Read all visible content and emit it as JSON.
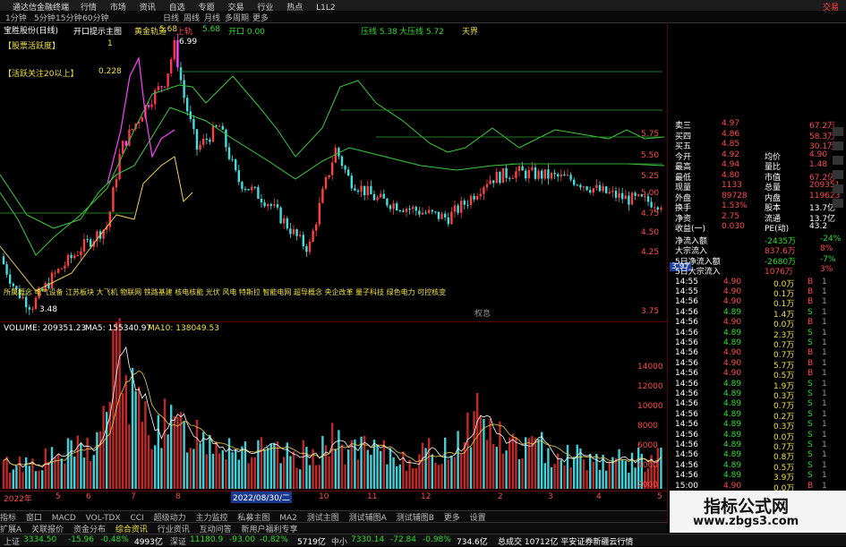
{
  "titlebar": {
    "app_title": "通达信金融终端",
    "menu": [
      "行情",
      "市场",
      "资讯",
      "自选",
      "专题",
      "交易",
      "行业",
      "热点",
      "L1L2"
    ],
    "close_label": "交易"
  },
  "toolbar": {
    "items": [
      "1分钟",
      "5分钟",
      "15分钟",
      "60分钟",
      "日线",
      "周线",
      "月线",
      "多周期",
      "更多"
    ]
  },
  "chart_header": {
    "stock": "宝胜股份(日线)",
    "line1": "开口提示主图",
    "line2": "黄金轨道",
    "val1": "5.68",
    "line3": "上轨",
    "val2": "5.68",
    "line4": "开口 0.00",
    "pressure": "压线 5.38",
    "big_pressure": "大压线 5.72",
    "tianzhou": "天界"
  },
  "labels": {
    "left1": "【股票活跃度】",
    "left1_val": "1",
    "left2": "【活跃关注20以上】",
    "left2_val": "0.228",
    "peak_price": "6.99",
    "low_price": "3.48",
    "concepts": "所属概念 电气设备 江苏板块 大飞机 物联网 铁路基建 核电核能 光伏 风电 特斯拉 智能电网 超导概念 央企改革 量子科技 绿色电力 可控核变",
    "fenhong": "权息"
  },
  "price_axis": [
    "5.75",
    "5.50",
    "5.25",
    "5.00",
    "4.75",
    "4.50",
    "4.25",
    "3.97",
    "3.75"
  ],
  "volume_header": {
    "label": "VOLUME: 209351.23",
    "ma5": "MA5: 155340.97",
    "ma10": "MA10: 138049.53"
  },
  "volume_axis": [
    "14000",
    "12000",
    "10000",
    "8000",
    "6000",
    "4000",
    "2000"
  ],
  "date_label": "2022/08/30/二",
  "date_axis": [
    "2022年",
    "5",
    "6",
    "7",
    "8",
    "9",
    "10",
    "11",
    "12",
    "2",
    "3",
    "4",
    "5"
  ],
  "bottom_tabs": [
    "指标",
    "窗口",
    "MACD",
    "VOL-TDX",
    "CCI",
    "超级动力",
    "主力监控",
    "私募主图",
    "MA2",
    "测试主图",
    "测试辅图A",
    "测试辅图B",
    "更多",
    "设置"
  ],
  "bottom_tabs2": [
    "扩展A",
    "关联报价",
    "资金分布",
    "综合资讯",
    "行业资讯",
    "互动问答",
    "新用户福利专享"
  ],
  "quote": {
    "rows": [
      {
        "label": "卖三",
        "v": "4.97",
        "v2": "67.2万"
      },
      {
        "label": "买四",
        "v": "4.86",
        "v2": "58.3万"
      },
      {
        "label": "买五",
        "v": "4.85",
        "v2": "30.1万"
      },
      {
        "label": "今开",
        "v": "4.92",
        "l2": "均价",
        "v2": "4.90"
      },
      {
        "label": "最高",
        "v": "4.94",
        "l2": "量比",
        "v2": "1.48"
      },
      {
        "label": "最低",
        "v": "4.80",
        "l2": "市值",
        "v2": "67.2亿"
      },
      {
        "label": "现量",
        "v": "1133",
        "l2": "总量",
        "v2": "209351"
      },
      {
        "label": "外盘",
        "v": "89728",
        "l2": "内盘",
        "v2": "119623"
      },
      {
        "label": "换手",
        "v": "1.53%",
        "l2": "股本",
        "v2": "13.7亿"
      },
      {
        "label": "净资",
        "v": "2.75",
        "l2": "流通",
        "v2": "13.7亿"
      },
      {
        "label": "收益(一)",
        "v": "0.030",
        "l2": "PE(动)",
        "v2": "43.2"
      }
    ],
    "flow": [
      {
        "label": "净流入额",
        "v": "-2435万",
        "p": "-24%"
      },
      {
        "label": "大宗流入",
        "v": "837.6万",
        "p": "8%"
      },
      {
        "label": "5日净流入额",
        "v": "-2680万",
        "p": "-7%"
      },
      {
        "label": "5日大宗流入",
        "v": "1076万",
        "p": "3%"
      }
    ],
    "ticks": [
      {
        "t": "14:55",
        "p": "4.90",
        "v": "0.0万",
        "s": "B",
        "n": "1"
      },
      {
        "t": "14:55",
        "p": "4.90",
        "v": "0.1万",
        "s": "B",
        "n": "1"
      },
      {
        "t": "14:56",
        "p": "4.90",
        "v": "0.1万",
        "s": "B",
        "n": "1"
      },
      {
        "t": "14:56",
        "p": "4.89",
        "v": "1.4万",
        "s": "S",
        "n": "1"
      },
      {
        "t": "14:56",
        "p": "4.90",
        "v": "0.0万",
        "s": "B",
        "n": "1"
      },
      {
        "t": "14:56",
        "p": "4.89",
        "v": "2.3万",
        "s": "S",
        "n": "1"
      },
      {
        "t": "14:56",
        "p": "4.89",
        "v": "0.7万",
        "s": "S",
        "n": "1"
      },
      {
        "t": "14:56",
        "p": "4.90",
        "v": "0.7万",
        "s": "B",
        "n": "1"
      },
      {
        "t": "14:56",
        "p": "4.90",
        "v": "5.7万",
        "s": "B",
        "n": "1"
      },
      {
        "t": "14:56",
        "p": "4.90",
        "v": "0.5万",
        "s": "B",
        "n": "1"
      },
      {
        "t": "14:56",
        "p": "4.89",
        "v": "1.9万",
        "s": "S",
        "n": "1"
      },
      {
        "t": "14:56",
        "p": "4.89",
        "v": "0.3万",
        "s": "S",
        "n": "1"
      },
      {
        "t": "14:56",
        "p": "4.89",
        "v": "0.7万",
        "s": "S",
        "n": "1"
      },
      {
        "t": "14:56",
        "p": "4.89",
        "v": "0.2万",
        "s": "S",
        "n": "1"
      },
      {
        "t": "14:56",
        "p": "4.89",
        "v": "0.3万",
        "s": "S",
        "n": "1"
      },
      {
        "t": "14:56",
        "p": "4.89",
        "v": "0.0万",
        "s": "S",
        "n": "1"
      },
      {
        "t": "14:56",
        "p": "4.89",
        "v": "0.7万",
        "s": "S",
        "n": "1"
      },
      {
        "t": "14:56",
        "p": "4.89",
        "v": "0.8万",
        "s": "S",
        "n": "1"
      },
      {
        "t": "14:56",
        "p": "4.89",
        "v": "0.5万",
        "s": "S",
        "n": "1"
      },
      {
        "t": "14:56",
        "p": "4.89",
        "v": "3.9万",
        "s": "S",
        "n": "1"
      },
      {
        "t": "15:00",
        "p": "4.90",
        "v": "0.0万",
        "s": "B",
        "n": "1"
      }
    ],
    "tabs": [
      "笔",
      "价",
      "细",
      "势",
      "联",
      "值",
      "主",
      "筹"
    ]
  },
  "status": {
    "sh": "上证",
    "sh_val": "3334.50",
    "sh_chg": "-15.96",
    "sh_pct": "-0.48%",
    "sh_amt": "4993亿",
    "sz": "深证",
    "sz_val": "11180.9",
    "sz_chg": "-93.00",
    "sz_pct": "-0.82%",
    "sz_amt": "5719亿",
    "zx": "中小",
    "zx_val": "7330.14",
    "zx_chg": "-72.84",
    "zx_pct": "-0.98%",
    "zx_amt": "734.6亿",
    "news": "总成交 10712亿 平安证券新疆云行情"
  },
  "watermark": {
    "title": "指标公式网",
    "url": "www.zbgs3.com"
  },
  "colors": {
    "up": "#ff3c3c",
    "down": "#40e0e0",
    "ma_green": "#3ccc3c",
    "ma_yellow": "#f0d050",
    "ma_magenta": "#ff40ff"
  }
}
